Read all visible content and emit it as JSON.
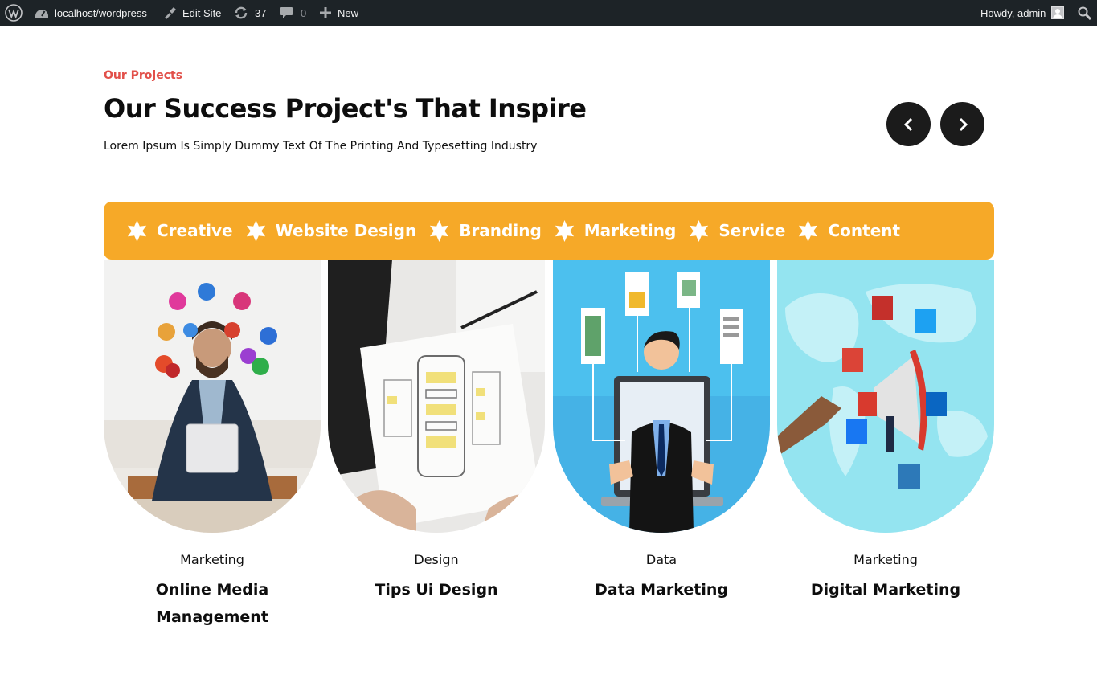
{
  "adminbar": {
    "site": "localhost/wordpress",
    "edit_site": "Edit Site",
    "updates": "37",
    "comments": "0",
    "new": "New",
    "howdy": "Howdy, admin"
  },
  "section": {
    "eyebrow": "Our Projects",
    "title": "Our Success Project's That Inspire",
    "subtitle": "Lorem Ipsum Is Simply Dummy Text Of The Printing And Typesetting Industry"
  },
  "ribbon": {
    "items": [
      "Creative",
      "Website Design",
      "Branding",
      "Marketing",
      "Service",
      "Content"
    ]
  },
  "cards": [
    {
      "category": "Marketing",
      "title": "Online Media Management"
    },
    {
      "category": "Design",
      "title": "Tips Ui Design"
    },
    {
      "category": "Data",
      "title": "Data Marketing"
    },
    {
      "category": "Marketing",
      "title": "Digital Marketing"
    }
  ],
  "colors": {
    "accent": "#f6a928",
    "eyebrow": "#e2504a",
    "adminbar": "#1d2327",
    "nav_button": "#1b1b1b"
  },
  "icons": {
    "nav_prev": "chevron-left-icon",
    "nav_next": "chevron-right-icon",
    "ribbon": "star-burst-icon"
  }
}
